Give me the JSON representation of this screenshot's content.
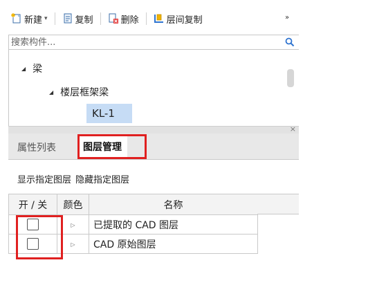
{
  "toolbar": {
    "new_label": "新建",
    "copy_label": "复制",
    "delete_label": "删除",
    "floor_copy_label": "层间复制",
    "more_label": "»"
  },
  "search": {
    "placeholder": "搜索构件..."
  },
  "tree": {
    "root_label": "梁",
    "child_label": "楼层框架梁",
    "leaf_label": "KL-1"
  },
  "tabs": {
    "properties": "属性列表",
    "layer_management": "图层管理"
  },
  "layer_actions": {
    "show_label": "显示指定图层",
    "hide_label": "隐藏指定图层"
  },
  "layer_table": {
    "headers": {
      "toggle": "开 / 关",
      "color": "颜色",
      "name": "名称"
    },
    "rows": [
      {
        "name": "已提取的 CAD 图层",
        "on": false
      },
      {
        "name": "CAD 原始图层",
        "on": false
      }
    ]
  },
  "colors": {
    "highlight_outline": "#e02020",
    "selection": "#c6dcf5",
    "tab_bar": "#e8e8e8"
  }
}
